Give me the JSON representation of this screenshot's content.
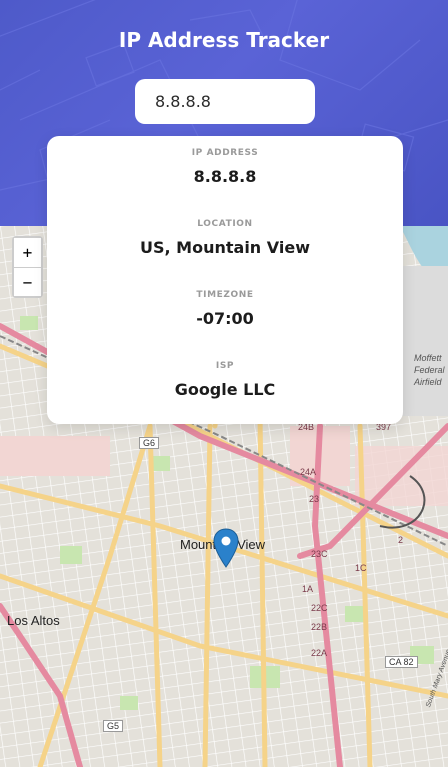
{
  "header": {
    "title": "IP Address Tracker"
  },
  "search": {
    "value": "8.8.8.8",
    "submit_label": ">"
  },
  "info": {
    "ip": {
      "label": "IP ADDRESS",
      "value": "8.8.8.8"
    },
    "location": {
      "label": "LOCATION",
      "value": "US, Mountain View"
    },
    "timezone": {
      "label": "TIMEZONE",
      "value": "-07:00"
    },
    "isp": {
      "label": "ISP",
      "value": "Google LLC"
    }
  },
  "map": {
    "zoom_in": "+",
    "zoom_out": "−",
    "labels": {
      "city": "Mountain View",
      "neighbor": "Los Altos",
      "airfield_1": "Moffett",
      "airfield_2": "Federal",
      "airfield_3": "Airfield",
      "road_g6": "G6",
      "road_g5": "G5",
      "road_ca82": "CA 82",
      "road_24b": "24B",
      "road_24a": "24A",
      "road_23": "23",
      "road_23c": "23C",
      "road_22c": "22C",
      "road_22b": "22B",
      "road_22a": "22A",
      "road_1a": "1A",
      "road_1c": "1C",
      "road_2": "2",
      "road_397": "397",
      "street_south_mary": "South Mary Avenue"
    }
  },
  "colors": {
    "header_bg": "#5a63d6",
    "marker": "#2a81cb",
    "highway": "#e58aa0",
    "primary_road": "#f5d389",
    "park": "#c8e6b0",
    "water": "#aad3df"
  },
  "icons": {
    "marker": "map-pin-icon"
  }
}
